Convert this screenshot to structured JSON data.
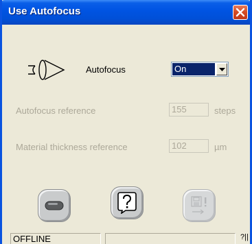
{
  "window": {
    "title": "Use Autofocus"
  },
  "autofocus": {
    "label": "Autofocus",
    "selected": "On",
    "icon": "lens-icon"
  },
  "autofocus_reference": {
    "label": "Autofocus reference",
    "value": "155",
    "unit": "steps",
    "enabled": false
  },
  "material_thickness": {
    "label": "Material thickness reference",
    "value": "102",
    "unit": "µm",
    "enabled": false
  },
  "buttons": [
    {
      "name": "minimize-button",
      "icon": "pill-icon",
      "enabled": true
    },
    {
      "name": "help-button",
      "icon": "question-icon",
      "enabled": true
    },
    {
      "name": "save-button",
      "icon": "save-disk-icon",
      "enabled": false
    }
  ],
  "status": {
    "state": "OFFLINE",
    "message": "",
    "extra": "?||"
  },
  "colors": {
    "titlebar": "#0054e3",
    "selection": "#0a246a",
    "disabled_text": "#aca899",
    "close": "#d24a22"
  }
}
